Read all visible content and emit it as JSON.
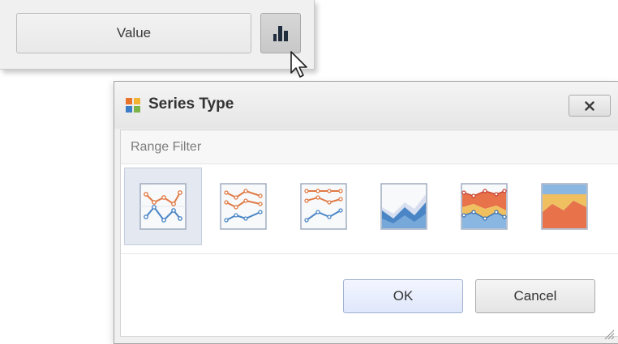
{
  "value_panel": {
    "value_label": "Value",
    "series_type_button_icon": "bar-chart-icon",
    "cursor_icon": "mouse-pointer-icon"
  },
  "dialog": {
    "title": "Series Type",
    "title_icon": "series-type-icon",
    "close_label": "X",
    "group_label": "Range Filter",
    "gallery_items": [
      {
        "name": "line",
        "icon": "line-series-icon",
        "selected": true
      },
      {
        "name": "stacked-line",
        "icon": "stacked-line-series-icon",
        "selected": false
      },
      {
        "name": "full-stacked-line",
        "icon": "full-stacked-line-series-icon",
        "selected": false
      },
      {
        "name": "area",
        "icon": "area-series-icon",
        "selected": false
      },
      {
        "name": "stacked-area",
        "icon": "stacked-area-series-icon",
        "selected": false
      },
      {
        "name": "full-stacked-area",
        "icon": "full-stacked-area-series-icon",
        "selected": false
      }
    ],
    "ok_label": "OK",
    "cancel_label": "Cancel"
  },
  "colors": {
    "orange_series": "#e07a45",
    "blue_series": "#4a86c5",
    "selection": "#e3e8f1",
    "ok_button": "#dfe7fb"
  }
}
